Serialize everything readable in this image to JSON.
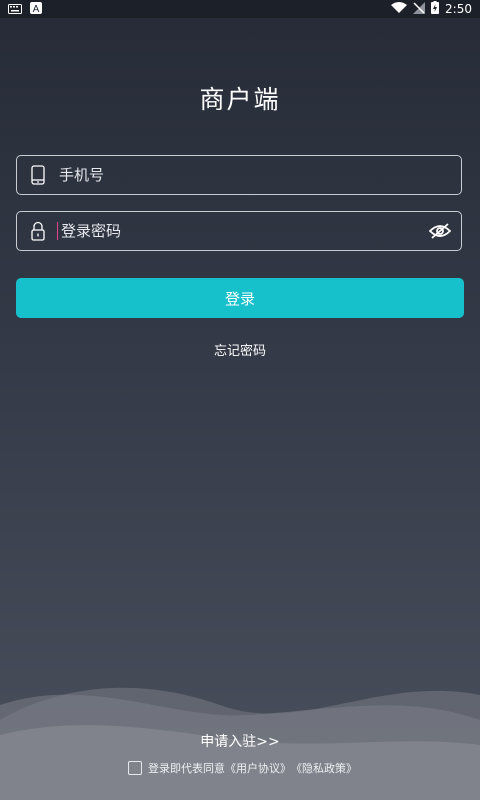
{
  "status": {
    "time": "2:50"
  },
  "title": "商户端",
  "phone": {
    "placeholder": "手机号"
  },
  "password": {
    "placeholder": "登录密码"
  },
  "login": {
    "label": "登录"
  },
  "forgot": {
    "label": "忘记密码"
  },
  "apply": {
    "label": "申请入驻>>"
  },
  "agreement": {
    "prefix": "登录即代表同意",
    "user_agreement": "《用户协议》",
    "privacy_policy": "《隐私政策》"
  },
  "colors": {
    "accent": "#17c1cc",
    "bg_top": "#262b37",
    "bg_bottom": "#4a505c",
    "caret": "#e0458c"
  }
}
